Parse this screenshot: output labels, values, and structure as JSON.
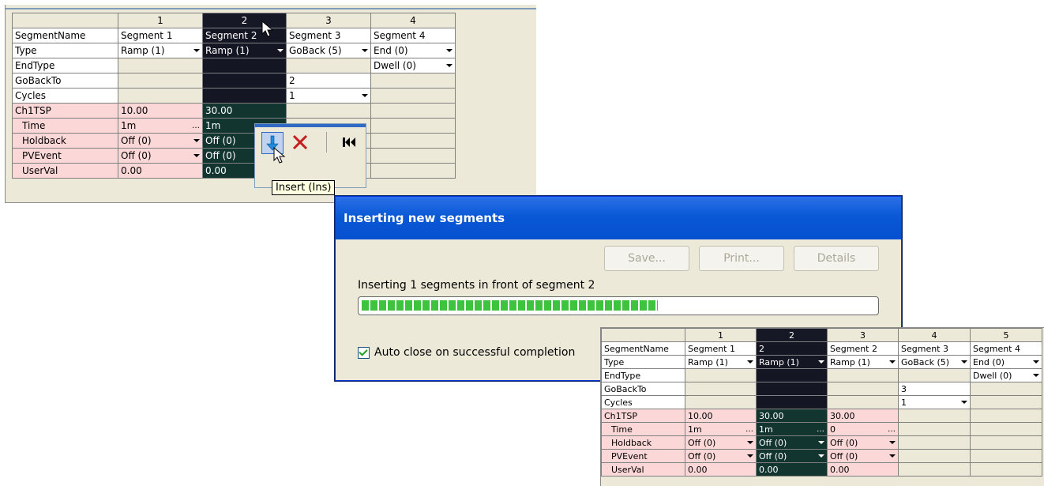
{
  "top_grid": {
    "columns": [
      "1",
      "2",
      "3",
      "4"
    ],
    "rows": [
      {
        "label": "SegmentName",
        "cells": [
          "Segment 1",
          "Segment 2",
          "Segment 3",
          "Segment 4"
        ]
      },
      {
        "label": "Type",
        "cells": [
          "Ramp (1)",
          "Ramp (1)",
          "GoBack (5)",
          "End (0)"
        ]
      },
      {
        "label": "EndType",
        "cells": [
          "",
          "",
          "",
          "Dwell (0)"
        ]
      },
      {
        "label": "GoBackTo",
        "cells": [
          "",
          "",
          "2",
          ""
        ]
      },
      {
        "label": "Cycles",
        "cells": [
          "",
          "",
          "1",
          ""
        ]
      },
      {
        "label": "Ch1TSP",
        "cells": [
          "10.00",
          "30.00",
          "",
          ""
        ]
      },
      {
        "label": "Time",
        "cells": [
          "1m",
          "1m",
          "",
          ""
        ]
      },
      {
        "label": "Holdback",
        "cells": [
          "Off (0)",
          "Off (0)",
          "",
          ""
        ]
      },
      {
        "label": "PVEvent",
        "cells": [
          "Off (0)",
          "Off (0)",
          "",
          ""
        ]
      },
      {
        "label": "UserVal",
        "cells": [
          "0.00",
          "0.00",
          "",
          ""
        ]
      }
    ]
  },
  "toolbar": {
    "tooltip": "Insert (Ins)",
    "icons": [
      "insert-arrow-down-icon",
      "delete-x-icon",
      "first-record-icon"
    ]
  },
  "dialog": {
    "title": "Inserting new segments",
    "save_label": "Save...",
    "print_label": "Print...",
    "details_label": "Details",
    "progress_text": "Inserting 1 segments in front of segment 2",
    "progress_fraction": 0.57,
    "autoclose_label": "Auto close on successful completion",
    "autoclose_checked": true
  },
  "bottom_grid": {
    "columns": [
      "1",
      "2",
      "3",
      "4",
      "5"
    ],
    "rows": [
      {
        "label": "SegmentName",
        "cells": [
          "Segment 1",
          "2",
          "Segment 2",
          "Segment 3",
          "Segment 4"
        ]
      },
      {
        "label": "Type",
        "cells": [
          "Ramp (1)",
          "Ramp (1)",
          "Ramp (1)",
          "GoBack (5)",
          "End (0)"
        ]
      },
      {
        "label": "EndType",
        "cells": [
          "",
          "",
          "",
          "",
          "Dwell (0)"
        ]
      },
      {
        "label": "GoBackTo",
        "cells": [
          "",
          "",
          "",
          "3",
          ""
        ]
      },
      {
        "label": "Cycles",
        "cells": [
          "",
          "",
          "",
          "1",
          ""
        ]
      },
      {
        "label": "Ch1TSP",
        "cells": [
          "10.00",
          "30.00",
          "30.00",
          "",
          ""
        ]
      },
      {
        "label": "Time",
        "cells": [
          "1m",
          "1m",
          "0",
          "",
          ""
        ]
      },
      {
        "label": "Holdback",
        "cells": [
          "Off (0)",
          "Off (0)",
          "Off (0)",
          "",
          ""
        ]
      },
      {
        "label": "PVEvent",
        "cells": [
          "Off (0)",
          "Off (0)",
          "Off (0)",
          "",
          ""
        ]
      },
      {
        "label": "UserVal",
        "cells": [
          "0.00",
          "0.00",
          "0.00",
          "",
          ""
        ]
      }
    ]
  },
  "colors": {
    "selected": "#141623",
    "selected_green": "#12352f",
    "pink": "#fbd7d8",
    "titlebar": "#0a58d6",
    "progress": "#3ec33e"
  }
}
